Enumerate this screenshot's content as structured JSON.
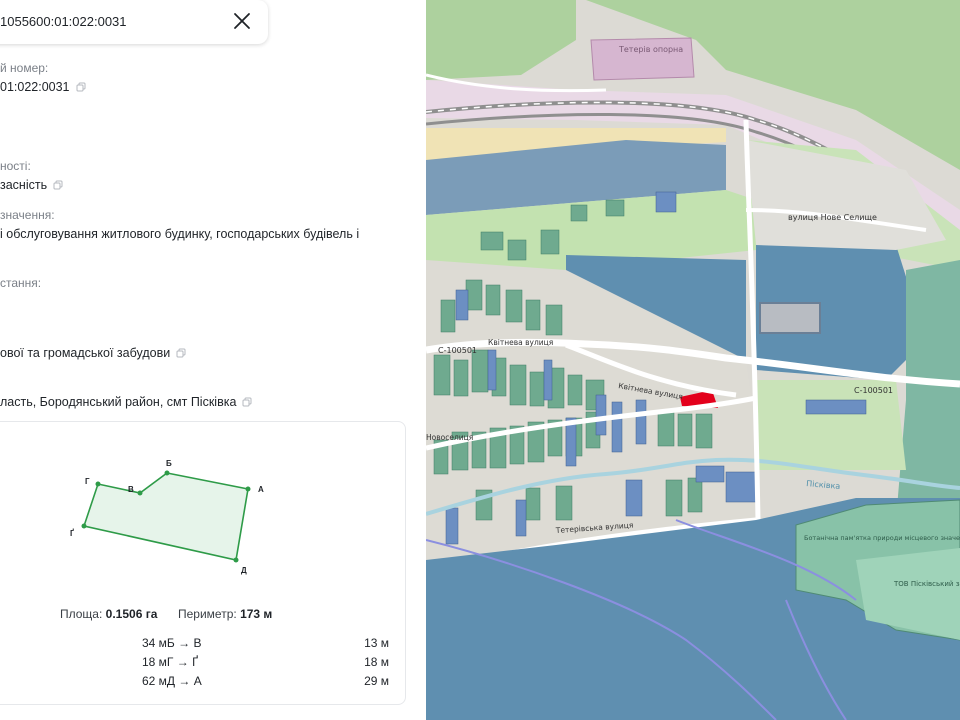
{
  "search": {
    "query": "1055600:01:022:0031"
  },
  "details": {
    "cadastral_label": "й номер:",
    "cadastral_value": "01:022:0031",
    "ownership_label": "ності:",
    "ownership_value": "засність",
    "purpose_label": "значення:",
    "purpose_value": "і обслуговування житлового будинку, господарських будівель і",
    "usage_label": "стання:",
    "category_value": "ової та громадської забудови",
    "address_value": "ласть, Бородянський район, смт Пісківка"
  },
  "shape": {
    "vertices": [
      "Б",
      "Г",
      "В",
      "А",
      "Ґ",
      "Д"
    ]
  },
  "stats": {
    "area_label": "Площа:",
    "area_value": "0.1506 га",
    "perimeter_label": "Периметр:",
    "perimeter_value": "173 м"
  },
  "edges": [
    {
      "desc": "34 мБ → В",
      "length": "13 м"
    },
    {
      "desc": "18 мГ → Ґ",
      "length": "18 м"
    },
    {
      "desc": "62 мД → А",
      "length": "29 м"
    }
  ],
  "map": {
    "labels": {
      "substation": "Тетерів опорна",
      "street_nove_selyshche": "вулиця Нове Селище",
      "road_code_left": "С-100501",
      "road_code_right": "С-100501",
      "street_kvitneva_1": "Квітнева вулиця",
      "street_kvitneva_2": "Квітнева вулиця",
      "street_novoselytsia": "Новоселиця",
      "street_teterivska": "Тетерівська вулиця",
      "river": "Пісківка",
      "reserve": "Ботанічна пам'ятка природи місцевого значення Дуба",
      "company": "ТОВ Пісківський завод скла"
    },
    "colors": {
      "parcel": "#e3001b",
      "water": "#a9d3df",
      "forest": "#add19e"
    }
  }
}
